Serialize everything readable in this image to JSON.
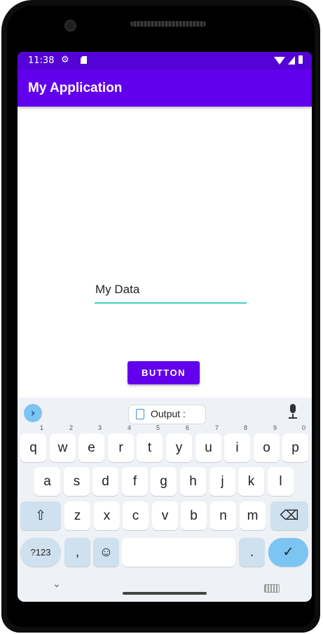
{
  "status_bar": {
    "time": "11:38",
    "icons": [
      "gear-icon",
      "sd-card-icon",
      "wifi-icon",
      "signal-icon",
      "battery-icon"
    ]
  },
  "app_bar": {
    "title": "My Application"
  },
  "main": {
    "edit_text_value": "My Data",
    "button_label": "BUTTON"
  },
  "colors": {
    "app_bar": "#6200ee",
    "status_bar": "#5502d6",
    "edit_underline": "#3fd0c4",
    "keyboard_accent": "#7cc4f2"
  },
  "keyboard": {
    "suggestion_chip": "Output :",
    "row1": [
      {
        "key": "q",
        "hint": "1"
      },
      {
        "key": "w",
        "hint": "2"
      },
      {
        "key": "e",
        "hint": "3"
      },
      {
        "key": "r",
        "hint": "4"
      },
      {
        "key": "t",
        "hint": "5"
      },
      {
        "key": "y",
        "hint": "6"
      },
      {
        "key": "u",
        "hint": "7"
      },
      {
        "key": "i",
        "hint": "8"
      },
      {
        "key": "o",
        "hint": "9"
      },
      {
        "key": "p",
        "hint": "0"
      }
    ],
    "row2": [
      "a",
      "s",
      "d",
      "f",
      "g",
      "h",
      "j",
      "k",
      "l"
    ],
    "row3": [
      "z",
      "x",
      "c",
      "v",
      "b",
      "n",
      "m"
    ],
    "symbols_key": "?123",
    "comma_key": ",",
    "emoji_key": "☺",
    "period_key": ".",
    "shift_key": "⇧",
    "backspace_key": "⌫",
    "enter_key": "✓",
    "expand_key": "›",
    "nav_down": "⌄"
  }
}
